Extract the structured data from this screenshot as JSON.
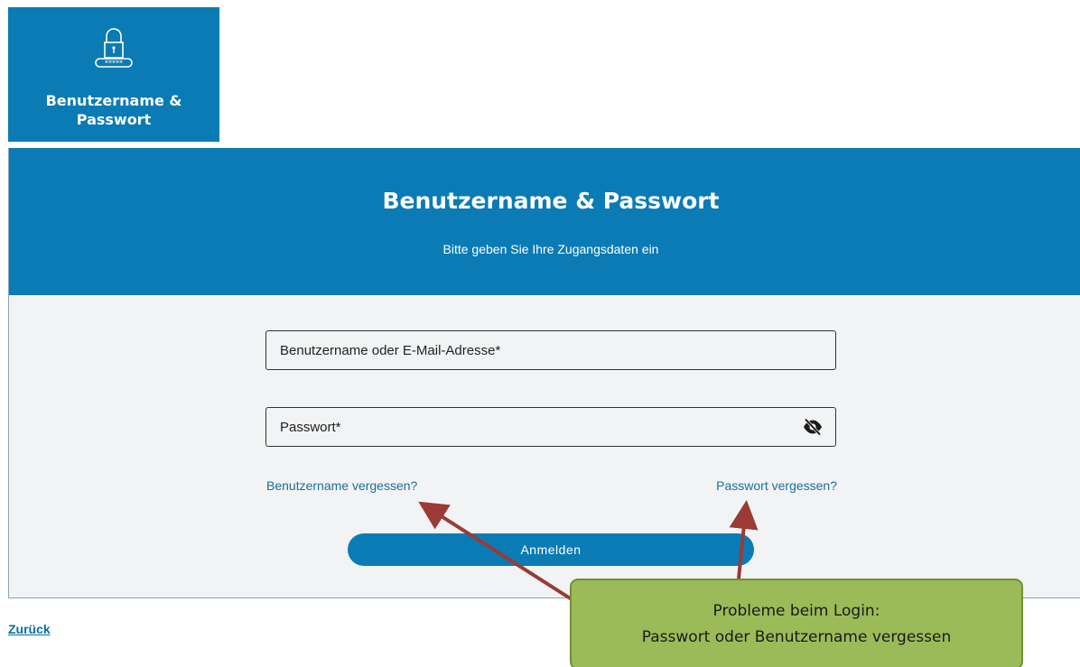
{
  "tile": {
    "label": "Benutzername &\nPasswort",
    "icon": "lock-password-icon"
  },
  "card": {
    "title": "Benutzername & Passwort",
    "subtitle": "Bitte geben Sie Ihre Zugangsdaten ein"
  },
  "form": {
    "username_placeholder": "Benutzername oder E-Mail-Adresse*",
    "password_placeholder": "Passwort*",
    "password_toggle_icon": "eye-slash-icon",
    "forgot_username": "Benutzername vergessen?",
    "forgot_password": "Passwort vergessen?",
    "login_button": "Anmelden"
  },
  "back_link": "Zurück",
  "annotation": {
    "line1": "Probleme beim Login:",
    "line2": "Passwort oder Benutzername vergessen"
  },
  "colors": {
    "brand_blue": "#0a7bb5",
    "link_blue": "#1d6e98",
    "callout_green": "#9bbb59",
    "arrow_red": "#9b3a36"
  }
}
